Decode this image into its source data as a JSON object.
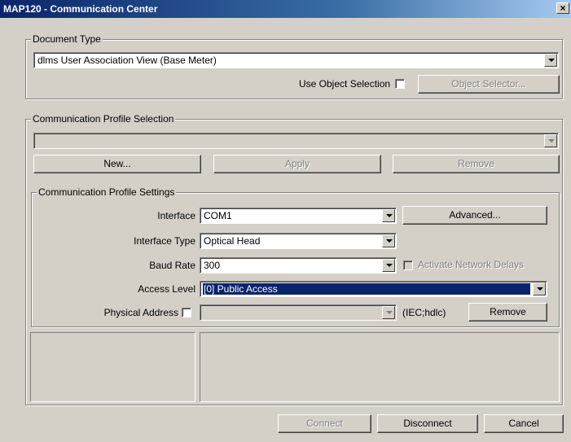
{
  "window": {
    "title": "MAP120 - Communication Center",
    "close_glyph": "×"
  },
  "document_type": {
    "legend": "Document Type",
    "selected": "dlms User Association View (Base Meter)",
    "use_object_selection_label": "Use Object Selection",
    "use_object_selection_checked": false,
    "object_selector_label": "Object Selector..."
  },
  "profile_selection": {
    "legend": "Communication Profile Selection",
    "selected": "",
    "new_label": "New...",
    "apply_label": "Apply",
    "remove_label": "Remove"
  },
  "profile_settings": {
    "legend": "Communication Profile Settings",
    "interface_label": "Interface",
    "interface_value": "COM1",
    "advanced_label": "Advanced...",
    "interface_type_label": "Interface Type",
    "interface_type_value": "Optical Head",
    "baud_rate_label": "Baud Rate",
    "baud_rate_value": "300",
    "activate_network_delays_label": "Activate Network Delays",
    "access_level_label": "Access Level",
    "access_level_value": "[0] Public Access",
    "physical_address_label": "Physical Address",
    "physical_address_value": "",
    "iec_hdlc_label": "(IEC;hdlc)",
    "remove_label": "Remove"
  },
  "footer": {
    "connect_label": "Connect",
    "disconnect_label": "Disconnect",
    "cancel_label": "Cancel"
  },
  "icons": {
    "dropdown": "chevron-down-icon",
    "close": "close-icon"
  }
}
